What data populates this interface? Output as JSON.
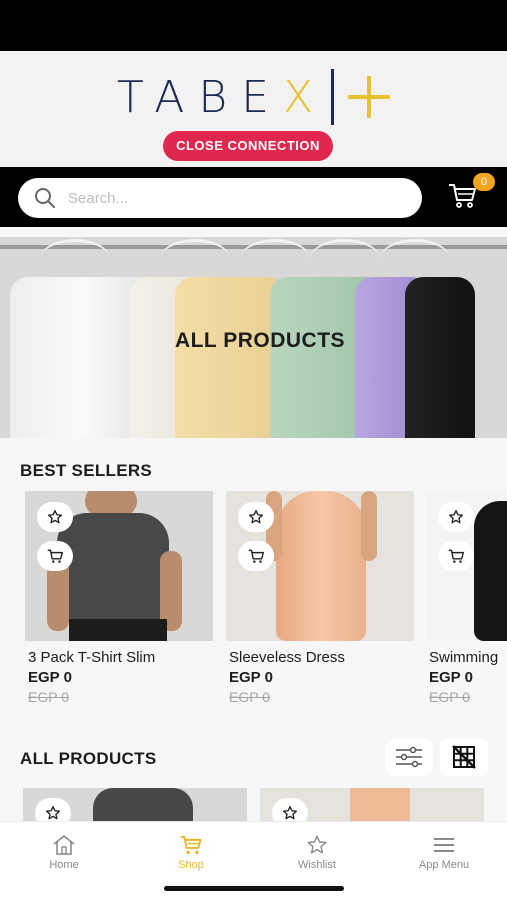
{
  "brand": {
    "logo_letters": "TABE",
    "logo_x": "X",
    "close_label": "CLOSE CONNECTION"
  },
  "search": {
    "placeholder": "Search..."
  },
  "cart": {
    "count": "0"
  },
  "hero": {
    "title": "ALL PRODUCTS"
  },
  "best_sellers": {
    "title": "BEST SELLERS",
    "products": [
      {
        "name": "3 Pack T-Shirt Slim",
        "price": "EGP 0",
        "old_price": "EGP 0"
      },
      {
        "name": "Sleeveless Dress",
        "price": "EGP 0",
        "old_price": "EGP 0"
      },
      {
        "name": "Swimming",
        "price": "EGP 0",
        "old_price": "EGP 0"
      }
    ]
  },
  "all_products": {
    "title": "ALL PRODUCTS"
  },
  "nav": {
    "items": [
      {
        "label": "Home",
        "icon": "home-icon"
      },
      {
        "label": "Shop",
        "icon": "cart-icon"
      },
      {
        "label": "Wishlist",
        "icon": "star-icon"
      },
      {
        "label": "App Menu",
        "icon": "menu-icon"
      }
    ],
    "active": "Shop"
  },
  "colors": {
    "accent_yellow": "#e9c233",
    "brand_navy": "#1b2a55",
    "close_red": "#e0284f",
    "badge_orange": "#f0a51e"
  }
}
